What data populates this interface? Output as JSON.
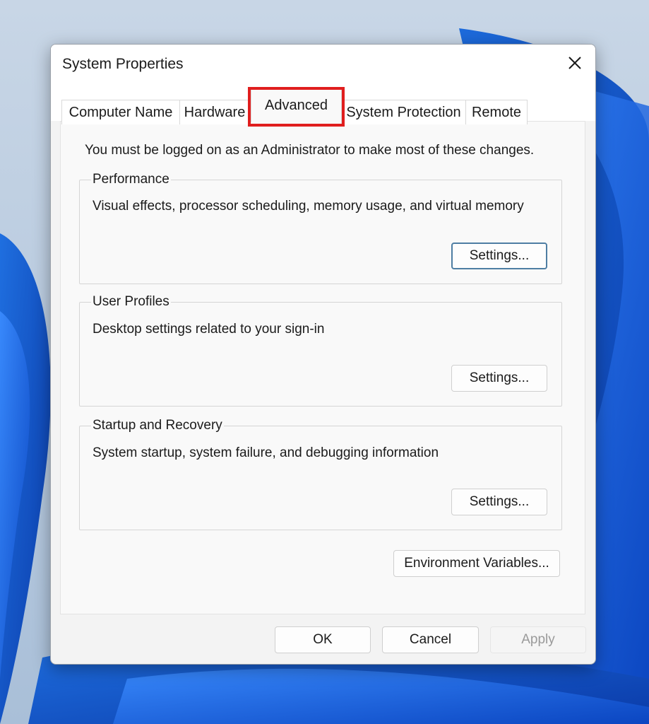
{
  "window": {
    "title": "System Properties",
    "close_icon": "close-icon"
  },
  "tabs": [
    {
      "label": "Computer Name",
      "active": false
    },
    {
      "label": "Hardware",
      "active": false
    },
    {
      "label": "Advanced",
      "active": true
    },
    {
      "label": "System Protection",
      "active": false
    },
    {
      "label": "Remote",
      "active": false
    }
  ],
  "highlight_color": "#e01e1e",
  "advanced": {
    "note": "You must be logged on as an Administrator to make most of these changes.",
    "performance": {
      "title": "Performance",
      "description": "Visual effects, processor scheduling, memory usage, and virtual memory",
      "button": "Settings..."
    },
    "user_profiles": {
      "title": "User Profiles",
      "description": "Desktop settings related to your sign-in",
      "button": "Settings..."
    },
    "startup_recovery": {
      "title": "Startup and Recovery",
      "description": "System startup, system failure, and debugging information",
      "button": "Settings..."
    },
    "environment_button": "Environment Variables..."
  },
  "footer": {
    "ok": "OK",
    "cancel": "Cancel",
    "apply": "Apply"
  }
}
